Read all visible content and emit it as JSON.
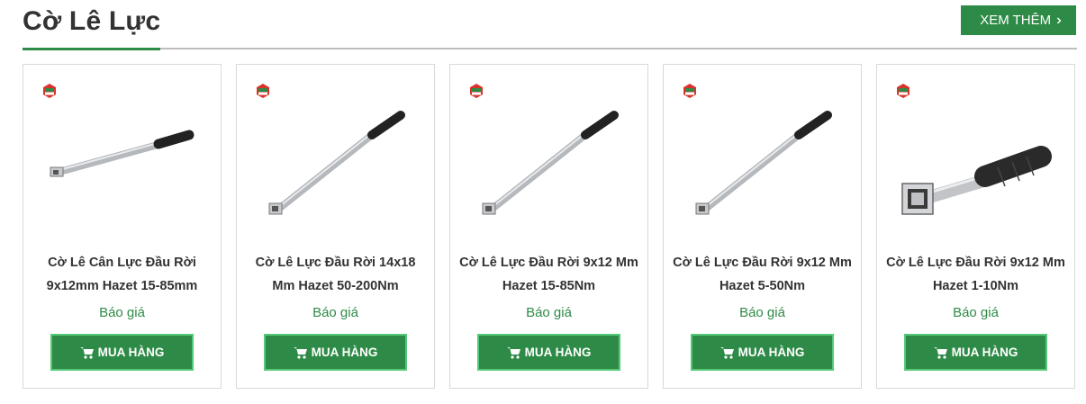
{
  "header": {
    "title": "Cờ Lê Lực",
    "more_label": "XEM THÊM",
    "more_icon": "double-chevron-right-icon"
  },
  "colors": {
    "accent": "#2e8b47",
    "button_border": "#56c977",
    "rule": "#bdbdbd"
  },
  "products": [
    {
      "name": "Cờ Lê Cân Lực Đầu Rời 9x12mm Hazet 15-85mm",
      "price": "Báo giá",
      "buy_label": "MUA HÀNG"
    },
    {
      "name": "Cờ Lê Lực Đầu Rời 14x18 Mm Hazet 50-200Nm",
      "price": "Báo giá",
      "buy_label": "MUA HÀNG"
    },
    {
      "name": "Cờ Lê Lực Đầu Rời 9x12 Mm Hazet 15-85Nm",
      "price": "Báo giá",
      "buy_label": "MUA HÀNG"
    },
    {
      "name": "Cờ Lê Lực Đầu Rời 9x12 Mm Hazet 5-50Nm",
      "price": "Báo giá",
      "buy_label": "MUA HÀNG"
    },
    {
      "name": "Cờ Lê Lực Đầu Rời 9x12 Mm Hazet 1-10Nm",
      "price": "Báo giá",
      "buy_label": "MUA HÀNG"
    }
  ]
}
